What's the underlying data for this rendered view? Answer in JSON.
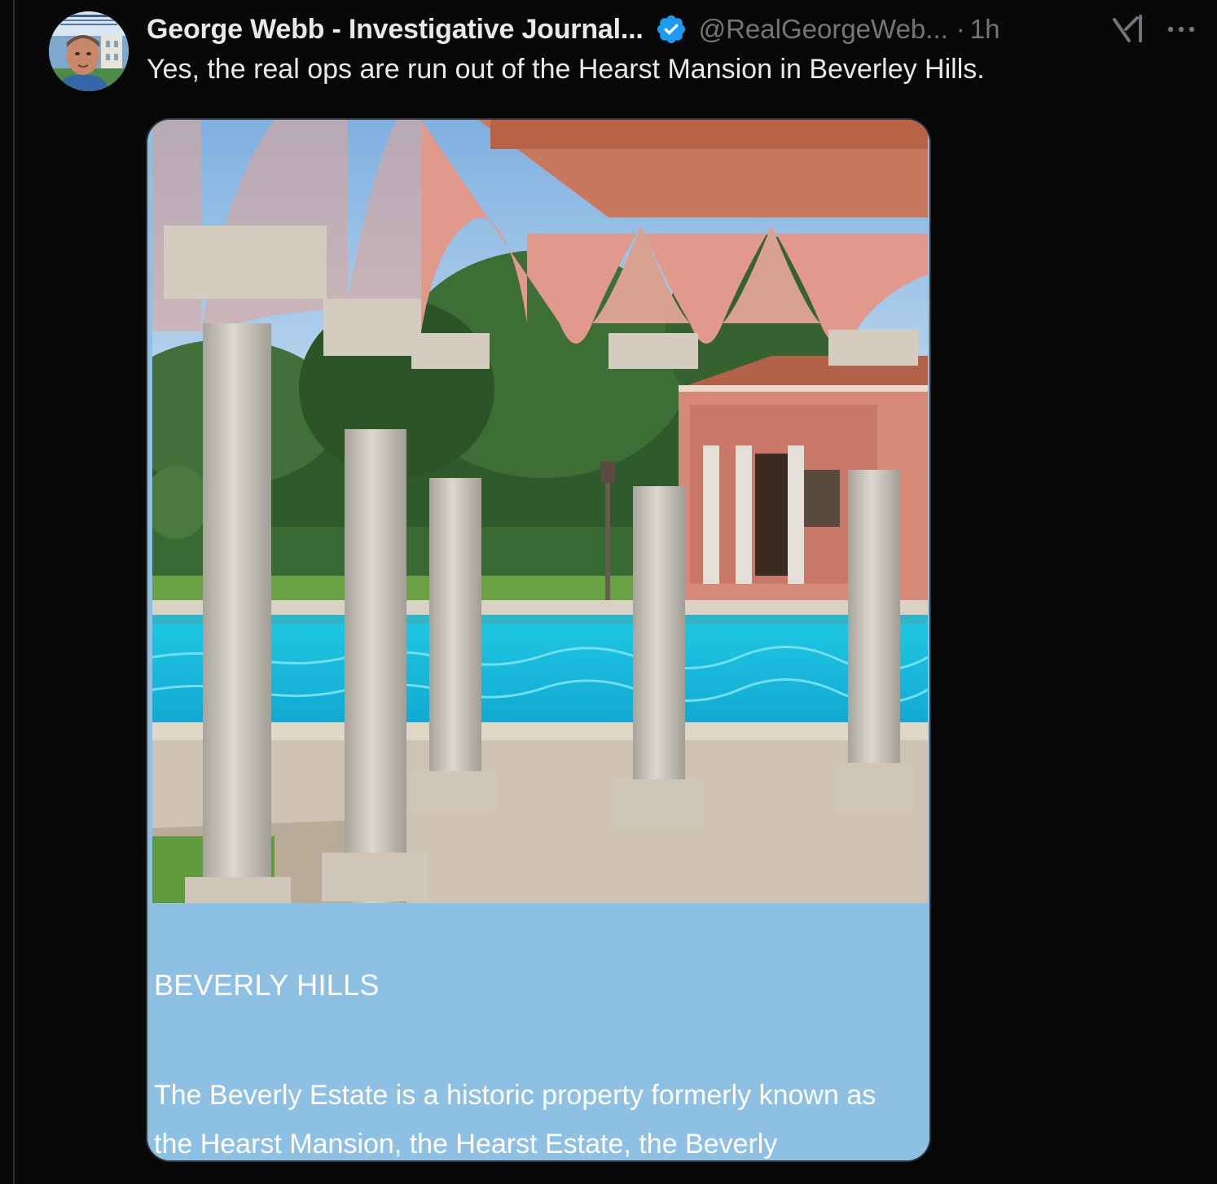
{
  "post": {
    "author_name": "George Webb - Investigative Journal...",
    "handle": "@RealGeorgeWeb...",
    "separator": "·",
    "time": "1h",
    "verified": true,
    "text": "Yes, the real ops are run out of the Hearst Mansion in Beverley Hills."
  },
  "media": {
    "caption_title": "BEVERLY HILLS",
    "caption_body": "The Beverly Estate is a historic property formerly known as the Hearst Mansion, the Hearst Estate, the Beverly"
  },
  "icons": {
    "verified": "verified-badge-icon",
    "grok": "grok-icon",
    "more": "more-options-icon"
  },
  "colors": {
    "background": "#080808",
    "primary_text": "#e7e9ea",
    "secondary_text": "#71767b",
    "verified_blue": "#1d9bf0",
    "caption_panel": "#8ec0e4"
  }
}
